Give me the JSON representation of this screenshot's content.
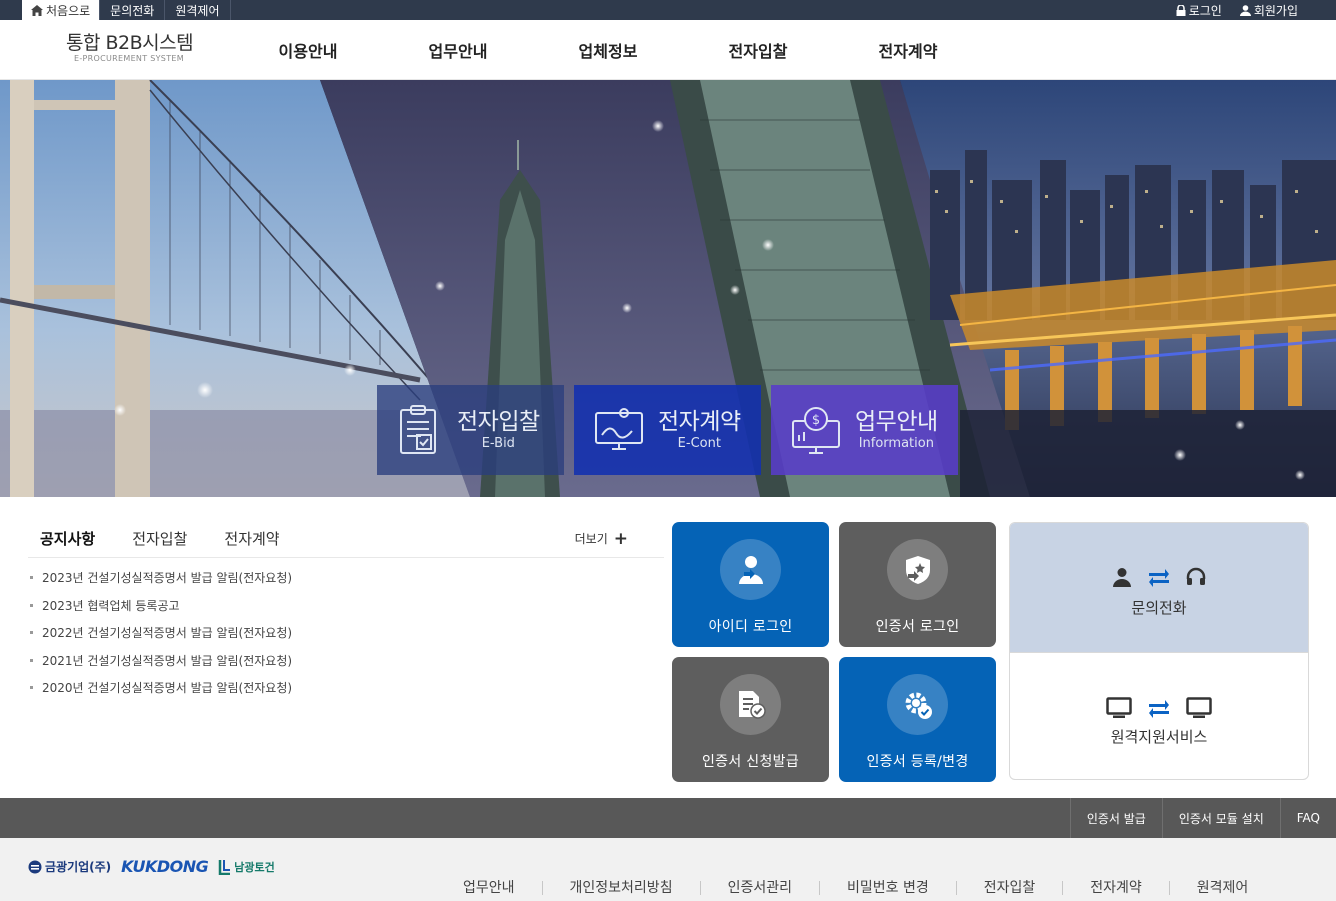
{
  "topbar": {
    "home": "처음으로",
    "inquiry": "문의전화",
    "remote": "원격제어",
    "login": "로그인",
    "signup": "회원가입"
  },
  "header": {
    "logo_title": "통합 B2B시스템",
    "logo_sub": "E-PROCUREMENT SYSTEM",
    "nav": [
      "이용안내",
      "업무안내",
      "업체정보",
      "전자입찰",
      "전자계약"
    ]
  },
  "hero": {
    "quick": [
      {
        "label": "전자입찰",
        "sub": "E-Bid",
        "icon": "clipboard-check-icon"
      },
      {
        "label": "전자계약",
        "sub": "E-Cont",
        "icon": "monitor-signature-icon"
      },
      {
        "label": "업무안내",
        "sub": "Information",
        "icon": "monitor-coin-icon"
      }
    ]
  },
  "notice": {
    "tabs": [
      "공지사항",
      "전자입찰",
      "전자계약"
    ],
    "more": "더보기",
    "items": [
      "2023년 건설기성실적증명서 발급 알림(전자요청)",
      "2023년 협력업체 등록공고",
      "2022년 건설기성실적증명서 발급 알림(전자요청)",
      "2021년 건설기성실적증명서 발급 알림(전자요청)",
      "2020년 건설기성실적증명서 발급 알림(전자요청)"
    ]
  },
  "tiles": {
    "id_login": "아이디 로그인",
    "cert_login": "인증서 로그인",
    "cert_issue": "인증서 신청발급",
    "cert_register": "인증서 등록/변경"
  },
  "support": {
    "phone_label": "문의전화",
    "remote_label": "원격지원서비스"
  },
  "footer": {
    "bar_links": [
      "인증서 발급",
      "인증서 모듈 설치",
      "FAQ"
    ],
    "logos": [
      "금광기업(주)",
      "KUKDONG",
      "남광토건"
    ],
    "menu": [
      "업무안내",
      "개인정보처리방침",
      "인증서관리",
      "비밀번호 변경",
      "전자입찰",
      "전자계약",
      "원격제어"
    ]
  },
  "colors": {
    "topbar": "#2f3a4c",
    "tile_blue": "#0563b6",
    "tile_gray": "#5e5e5e",
    "support_top": "#c8d3e4",
    "footer_bar": "#585858"
  }
}
